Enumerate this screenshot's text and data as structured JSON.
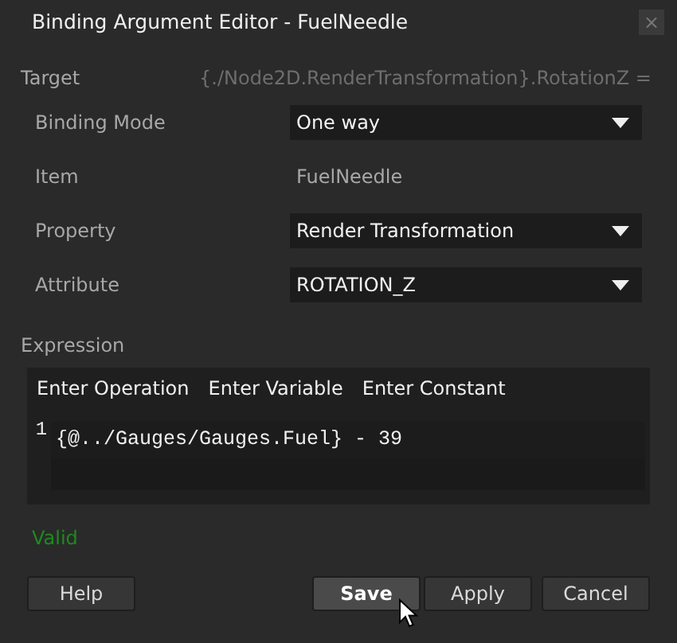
{
  "window": {
    "title": "Binding Argument Editor - FuelNeedle",
    "close": "×"
  },
  "target": {
    "label": "Target",
    "value": "{./Node2D.RenderTransformation}.RotationZ ="
  },
  "fields": [
    {
      "kind": "dropdown",
      "label": "Binding Mode",
      "value": "One way"
    },
    {
      "kind": "text",
      "label": "Item",
      "value": "FuelNeedle"
    },
    {
      "kind": "dropdown",
      "label": "Property",
      "value": "Render Transformation"
    },
    {
      "kind": "dropdown",
      "label": "Attribute",
      "value": "ROTATION_Z"
    }
  ],
  "expression": {
    "label": "Expression",
    "toolbar": [
      "Enter Operation",
      "Enter Variable",
      "Enter Constant"
    ],
    "lines": [
      {
        "number": "1",
        "code": "{@../Gauges/Gauges.Fuel} - 39"
      }
    ]
  },
  "validation": {
    "text": "Valid",
    "valid": true
  },
  "buttons": [
    {
      "label": "Help",
      "hovered": false
    },
    {
      "label": "Save",
      "hovered": true
    },
    {
      "label": "Apply",
      "hovered": false
    },
    {
      "label": "Cancel",
      "hovered": false
    }
  ]
}
